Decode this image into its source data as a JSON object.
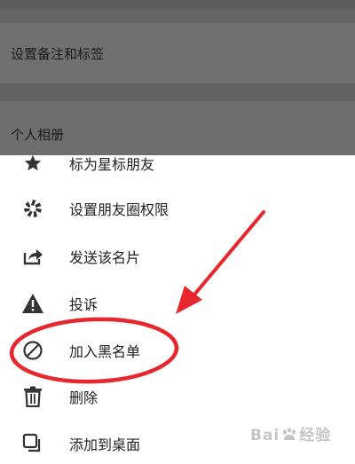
{
  "background": {
    "remark_label": "设置备注和标签",
    "album_label": "个人相册"
  },
  "menu": {
    "items": [
      {
        "label": "标为星标朋友",
        "icon": "star-icon"
      },
      {
        "label": "设置朋友圈权限",
        "icon": "aperture-icon"
      },
      {
        "label": "发送该名片",
        "icon": "share-icon"
      },
      {
        "label": "投诉",
        "icon": "warning-icon"
      },
      {
        "label": "加入黑名单",
        "icon": "block-icon"
      },
      {
        "label": "删除",
        "icon": "trash-icon"
      },
      {
        "label": "添加到桌面",
        "icon": "add-to-desktop-icon"
      }
    ]
  },
  "annotation": {
    "color": "#e8262d",
    "target": "加入黑名单"
  },
  "watermark": {
    "text_left": "Bai",
    "text_right": "经验"
  }
}
